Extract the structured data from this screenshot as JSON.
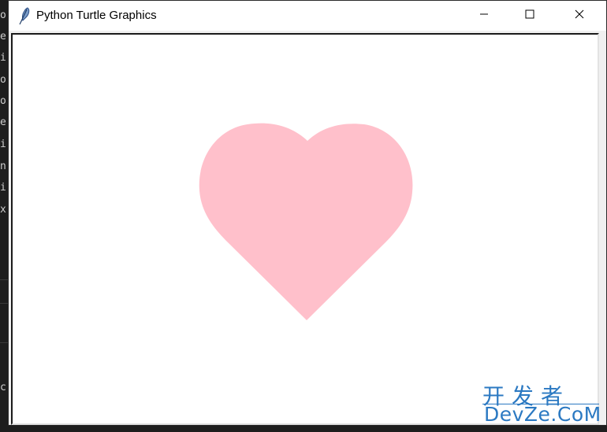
{
  "window": {
    "title": "Python Turtle Graphics",
    "icon": "feather-icon",
    "controls": [
      "minimize-icon",
      "maximize-icon",
      "close-icon"
    ]
  },
  "background_terminal": {
    "visible_chars": [
      "o",
      "e",
      "i",
      "o",
      "o",
      "e",
      "i",
      "n",
      "i",
      "x",
      "c"
    ]
  },
  "canvas": {
    "background": "#ffffff",
    "shape": "heart",
    "fill_color": "#ffc0cb"
  },
  "watermark": {
    "line1": "开发者",
    "line2": "DevZe.CoM",
    "color": "#2b79c2"
  }
}
